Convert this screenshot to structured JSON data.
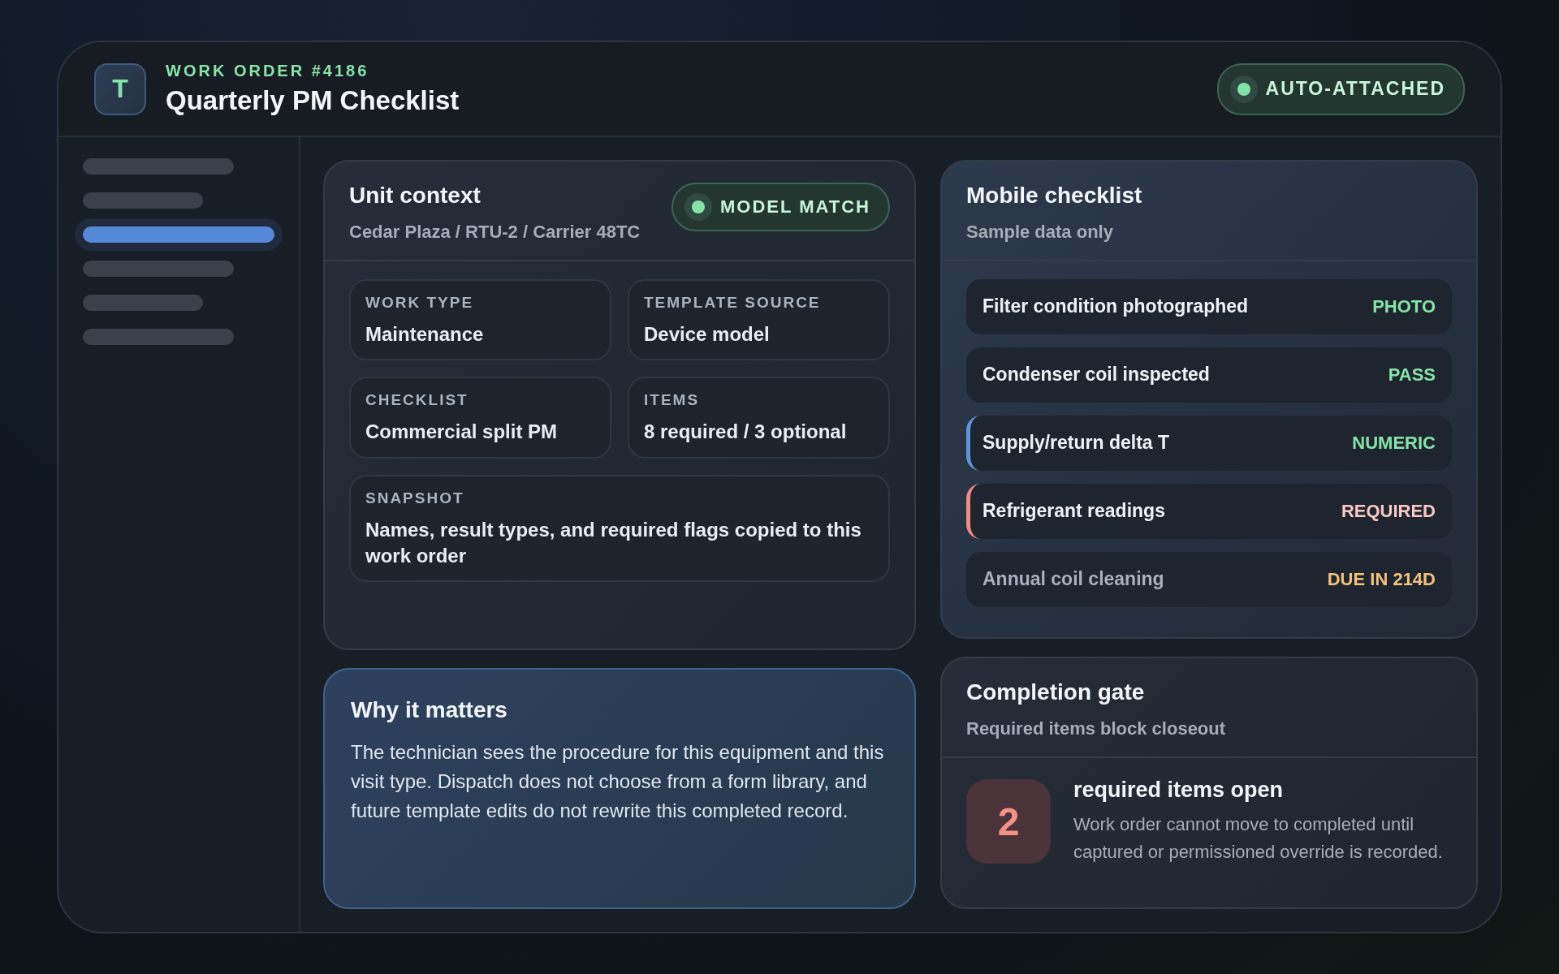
{
  "header": {
    "logo": "T",
    "eyebrow": "WORK ORDER #4186",
    "title": "Quarterly PM Checklist",
    "badge": "AUTO-ATTACHED"
  },
  "sidebar": {
    "items": [
      {
        "selected": false
      },
      {
        "selected": false
      },
      {
        "selected": true
      },
      {
        "selected": false
      },
      {
        "selected": false
      },
      {
        "selected": false
      }
    ]
  },
  "unit_context": {
    "title": "Unit context",
    "subtitle": "Cedar Plaza / RTU-2 / Carrier 48TC",
    "badge": "MODEL MATCH",
    "fields": [
      {
        "kind": "half",
        "label": "WORK TYPE",
        "value": "Maintenance"
      },
      {
        "kind": "half",
        "label": "TEMPLATE SOURCE",
        "value": "Device model"
      },
      {
        "kind": "half",
        "label": "CHECKLIST",
        "value": "Commercial split PM"
      },
      {
        "kind": "half",
        "label": "ITEMS",
        "value": "8 required / 3 optional"
      },
      {
        "kind": "wide",
        "label": "SNAPSHOT",
        "value": "Names, result types, and required flags copied to this work order"
      }
    ]
  },
  "why_it_matters": {
    "title": "Why it matters",
    "text": "The technician sees the procedure for this equipment and this visit type. Dispatch does not choose from a form library, and future template edits do not rewrite this completed record."
  },
  "mobile_checklist": {
    "title": "Mobile checklist",
    "subtitle": "Sample data only",
    "items": [
      {
        "kind": "normal",
        "name": "Filter condition photographed",
        "tag": "PHOTO",
        "color": "#86e3a8"
      },
      {
        "kind": "normal",
        "name": "Condenser coil inspected",
        "tag": "PASS",
        "color": "#86e3a8"
      },
      {
        "kind": "active",
        "name": "Supply/return delta T",
        "tag": "NUMERIC",
        "color": "#86e3a8"
      },
      {
        "kind": "required",
        "name": "Refrigerant readings",
        "tag": "REQUIRED",
        "color": "#f7c9c4"
      },
      {
        "kind": "muted",
        "name": "Annual coil cleaning",
        "tag": "DUE IN 214D",
        "color": "#f1c27d"
      }
    ]
  },
  "completion_gate": {
    "title": "Completion gate",
    "subtitle": "Required items block closeout",
    "count": "2",
    "count_label": "required items open",
    "text": "Work order cannot move to completed until captured or permissioned override is recorded."
  }
}
